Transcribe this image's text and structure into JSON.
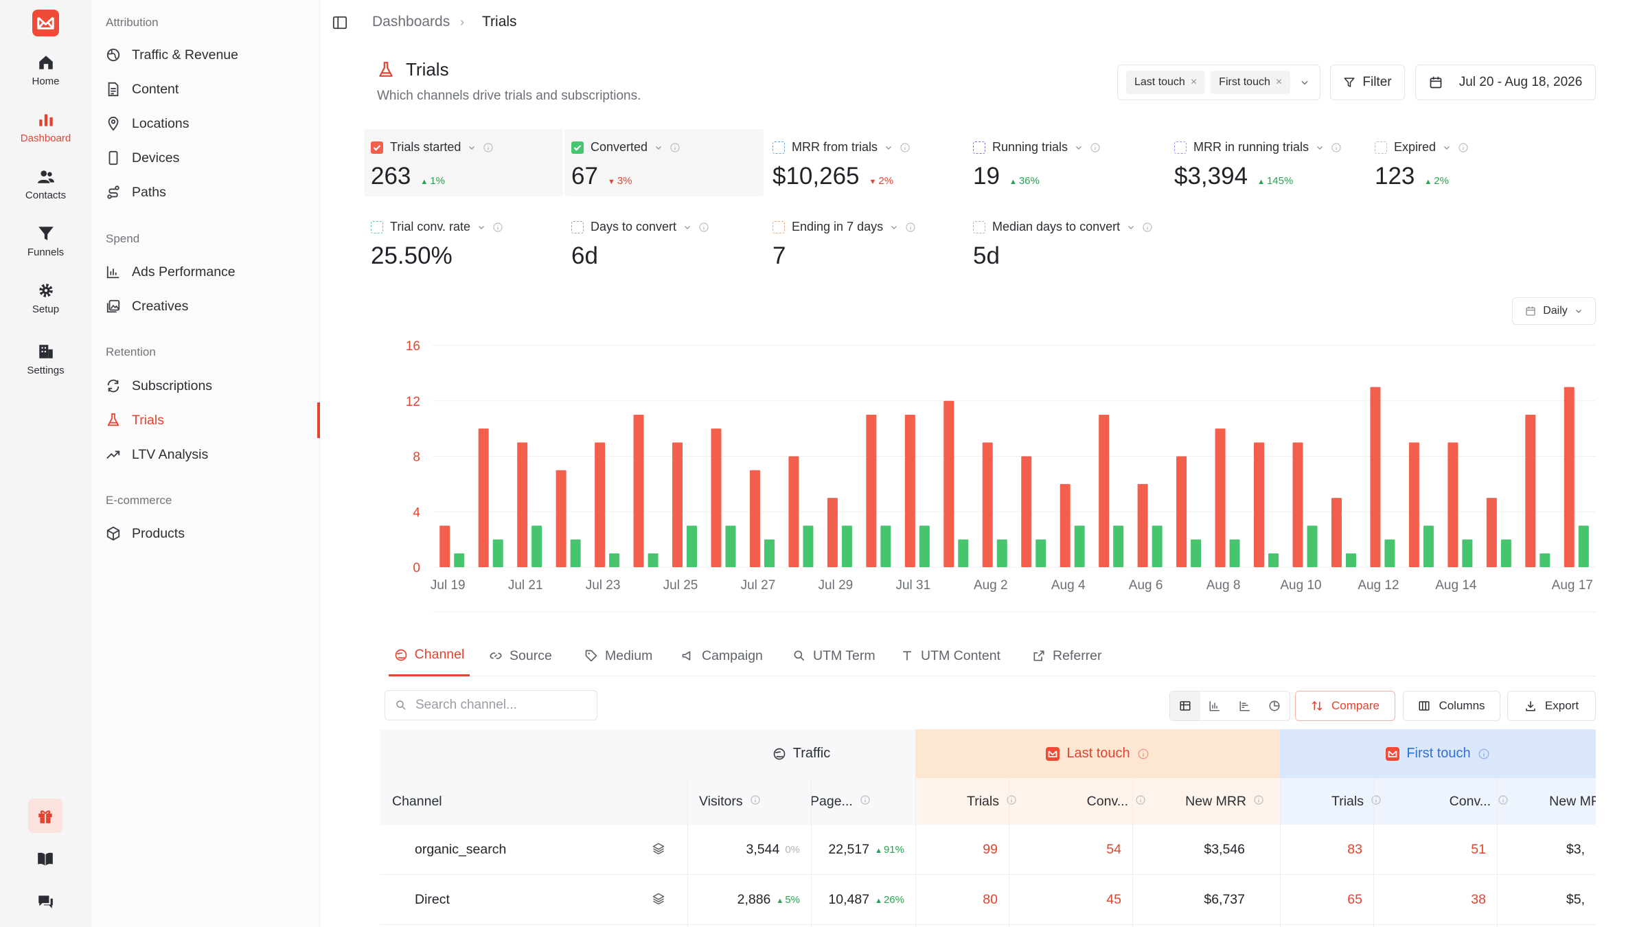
{
  "rail": {
    "items": [
      {
        "label": "Home",
        "icon": "home-icon"
      },
      {
        "label": "Dashboard",
        "icon": "bar-chart-icon"
      },
      {
        "label": "Contacts",
        "icon": "users-icon"
      },
      {
        "label": "Funnels",
        "icon": "funnel-icon"
      },
      {
        "label": "Setup",
        "icon": "gear-icon"
      },
      {
        "label": "Settings",
        "icon": "building-icon"
      }
    ],
    "active": "Dashboard"
  },
  "sidebar": {
    "groups": [
      {
        "title": "Attribution",
        "items": [
          "Traffic & Revenue",
          "Content",
          "Locations",
          "Devices",
          "Paths"
        ]
      },
      {
        "title": "Spend",
        "items": [
          "Ads Performance",
          "Creatives"
        ]
      },
      {
        "title": "Retention",
        "items": [
          "Subscriptions",
          "Trials",
          "LTV Analysis"
        ]
      },
      {
        "title": "E-commerce",
        "items": [
          "Products"
        ]
      }
    ],
    "active_item": "Trials"
  },
  "breadcrumb": {
    "parent": "Dashboards",
    "current": "Trials"
  },
  "header": {
    "title": "Trials",
    "subtitle": "Which channels drive trials and subscriptions.",
    "attribution_chips": [
      "Last touch",
      "First touch"
    ],
    "filter_label": "Filter",
    "date_range": "Jul 20 - Aug 18, 2026"
  },
  "colors": {
    "accent": "#e3432f",
    "bar_red": "#f25f4c",
    "bar_green": "#46c46e",
    "up": "#26a34f",
    "down": "#e3432f"
  },
  "kpis": [
    {
      "label": "Trials started",
      "value": "263",
      "delta": "1%",
      "direction": "up",
      "selected": true,
      "color": "#f25f4c"
    },
    {
      "label": "Converted",
      "value": "67",
      "delta": "3%",
      "direction": "down",
      "selected": true,
      "color": "#46c46e"
    },
    {
      "label": "MRR from trials",
      "value": "$10,265",
      "delta": "2%",
      "direction": "down",
      "selected": false,
      "color": "#5aa9e6"
    },
    {
      "label": "Running trials",
      "value": "19",
      "delta": "36%",
      "direction": "up",
      "selected": false,
      "color": "#7b6fe0"
    },
    {
      "label": "MRR in running trials",
      "value": "$3,394",
      "delta": "145%",
      "direction": "up",
      "selected": false,
      "color": "#a78bfa"
    },
    {
      "label": "Expired",
      "value": "123",
      "delta": "2%",
      "direction": "up",
      "selected": false,
      "color": "#bdbdc2"
    },
    {
      "label": "Trial conv. rate",
      "value": "25.50%",
      "delta": "",
      "direction": "",
      "selected": false,
      "color": "#5bc8b0"
    },
    {
      "label": "Days to convert",
      "value": "6d",
      "delta": "",
      "direction": "",
      "selected": false,
      "color": "#9aa0a8"
    },
    {
      "label": "Ending in 7 days",
      "value": "7",
      "delta": "",
      "direction": "",
      "selected": false,
      "color": "#f4a56a"
    },
    {
      "label": "Median days to convert",
      "value": "5d",
      "delta": "",
      "direction": "",
      "selected": false,
      "color": "#b0b4ba"
    }
  ],
  "interval": "Daily",
  "chart_data": {
    "type": "bar",
    "categories": [
      "Jul 19",
      "Jul 20",
      "Jul 21",
      "Jul 22",
      "Jul 23",
      "Jul 24",
      "Jul 25",
      "Jul 26",
      "Jul 27",
      "Jul 28",
      "Jul 29",
      "Jul 30",
      "Jul 31",
      "Aug 1",
      "Aug 2",
      "Aug 3",
      "Aug 4",
      "Aug 5",
      "Aug 6",
      "Aug 7",
      "Aug 8",
      "Aug 9",
      "Aug 10",
      "Aug 11",
      "Aug 12",
      "Aug 13",
      "Aug 14",
      "Aug 15",
      "Aug 16",
      "Aug 17"
    ],
    "x_tick_labels": [
      "Jul 19",
      "Jul 21",
      "Jul 23",
      "Jul 25",
      "Jul 27",
      "Jul 29",
      "Jul 31",
      "Aug 2",
      "Aug 4",
      "Aug 6",
      "Aug 8",
      "Aug 10",
      "Aug 12",
      "Aug 14",
      "Aug 17"
    ],
    "series": [
      {
        "color": "#f25f4c",
        "values": [
          3,
          10,
          9,
          7,
          9,
          11,
          9,
          10,
          7,
          8,
          5,
          11,
          11,
          12,
          9,
          8,
          6,
          11,
          6,
          8,
          10,
          9,
          9,
          5,
          13,
          9,
          9,
          5,
          11,
          13
        ]
      },
      {
        "color": "#46c46e",
        "values": [
          1,
          2,
          3,
          2,
          1,
          1,
          3,
          3,
          2,
          3,
          3,
          3,
          3,
          2,
          2,
          2,
          3,
          3,
          3,
          2,
          2,
          1,
          3,
          1,
          2,
          3,
          2,
          2,
          1,
          3
        ]
      }
    ],
    "ylim": [
      0,
      16
    ],
    "y_ticks": [
      0,
      4,
      8,
      12,
      16
    ],
    "grid": true
  },
  "tabs": [
    "Channel",
    "Source",
    "Medium",
    "Campaign",
    "UTM Term",
    "UTM Content",
    "Referrer"
  ],
  "active_tab": "Channel",
  "table_toolbar": {
    "search_placeholder": "Search channel...",
    "compare_label": "Compare",
    "columns_label": "Columns",
    "export_label": "Export"
  },
  "table": {
    "groups": [
      "Traffic",
      "Last touch",
      "First touch"
    ],
    "columns": [
      "Channel",
      "Visitors",
      "Page...",
      "Trials",
      "Conv...",
      "New MRR",
      "Trials",
      "Conv...",
      "New MRR"
    ],
    "rows": [
      {
        "channel": "organic_search",
        "visitors": "3,544",
        "visitors_delta": "0%",
        "visitors_dir": "flat",
        "pages": "22,517",
        "pages_delta": "91%",
        "pages_dir": "up",
        "lt_trials": "99",
        "lt_conv": "54",
        "lt_mrr": "$3,546",
        "ft_trials": "83",
        "ft_conv": "51",
        "ft_mrr": "$3,"
      },
      {
        "channel": "Direct",
        "visitors": "2,886",
        "visitors_delta": "5%",
        "visitors_dir": "up",
        "pages": "10,487",
        "pages_delta": "26%",
        "pages_dir": "up",
        "lt_trials": "80",
        "lt_conv": "45",
        "lt_mrr": "$6,737",
        "ft_trials": "65",
        "ft_conv": "38",
        "ft_mrr": "$5,"
      }
    ]
  }
}
